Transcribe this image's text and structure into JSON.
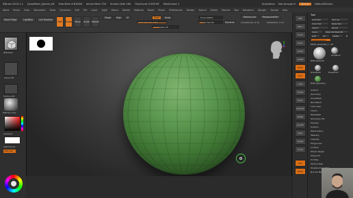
{
  "titlebar": {
    "items": [
      "ZBrush 2023.1.1",
      "DynaMesh_Sphere_64",
      "Free Mem 8.639GB",
      "Active Mem 726",
      "Scratch Disk 165",
      "PolyCount 0.009 KP",
      "MeshCount 1"
    ],
    "right": [
      "QuickSave",
      "See-through 0",
      "Menus",
      "DefaultZScript"
    ],
    "menus_label": "Menus"
  },
  "menubar": {
    "items": [
      "Alpha",
      "Brush",
      "Color",
      "Document",
      "Draw",
      "Dynamics",
      "Edit",
      "File",
      "Layer",
      "Light",
      "Macro",
      "Marker",
      "Material",
      "Movie",
      "Picker",
      "Preferences",
      "Render",
      "Stencil",
      "Stroke",
      "Texture",
      "Tool",
      "Transform",
      "Zplugin",
      "Zscript",
      "Help"
    ]
  },
  "toolbar": {
    "home_page": "Home Page",
    "lightbox": "LightBox",
    "live_boolean": "Live Boolean",
    "edit": "Edit",
    "draw": "Draw",
    "move": "Move",
    "scale": "Scale",
    "rotate": "Rotate",
    "mrgb": "Mrgb",
    "rgb": "Rgb",
    "m": "M",
    "zadd": "Zadd",
    "zsub": "Zsub",
    "focal_shift": "Focal Shift 0",
    "draw_size": "Draw Size 64",
    "dynamic": "Dynamic",
    "replay_last": "ReplayLast",
    "replay_last_rel": "ReplayLastRel",
    "rgb_intensity": "Rgb Intensity 100",
    "z_intensity": "Z Intensity 25",
    "active_points": "ActivePoints: 9.7K",
    "total_points": "TotalPoints: 9.7K"
  },
  "lefttray": {
    "brush_label": "ZModeler",
    "alpha_label": "Alpha Off",
    "texture_label": "Texture Off",
    "material_label": "MatCap Gray",
    "gradient_label": "Gradient",
    "switch_color_label": "SwitchColor",
    "alternate_label": "Alternate"
  },
  "rightshelf": {
    "buttons": [
      "BPR",
      "SPix 3",
      "Scroll",
      "Zoom",
      "Actual",
      "AAHalf",
      "Persp",
      "Floor",
      "L.Sym",
      "Frame",
      "Move",
      "Zoom3D",
      "Rotate",
      "Line Fill",
      "PolyF",
      "Transp",
      "Ghost",
      "Solo",
      "Xpose"
    ]
  },
  "toolpanel": {
    "title": "Tool",
    "load_tool": "Load Tool",
    "save_as": "Save As",
    "copy_tool": "Copy Tool",
    "paste_tool": "Paste Tool",
    "import": "Import",
    "export": "Export",
    "clone": "Clone",
    "make_polymesh": "Make PolyMesh3D",
    "goz": "GoZ",
    "all": "All",
    "visible": "Visible",
    "r": "R",
    "lightbox_tools": "Lightbox▸Tools",
    "current_tool": "PM3D_Sphere3D_1 : 48",
    "tools": [
      "PM3D_Sphere3D",
      "AlphaBrush",
      "SimpleBrush",
      "EraserBrush",
      "PM3D_Sphere3D_1"
    ],
    "subpanels": [
      "Subtool",
      "Geometry",
      "ArrayMesh",
      "NanoMesh",
      "Thick Skin",
      "Layers",
      "FiberMesh",
      "Geometry HD",
      "Preview",
      "Surface",
      "Deformation",
      "Masking",
      "Visibility",
      "Polygroups",
      "Contact",
      "Morph Target",
      "Polypaint",
      "UV Map",
      "Texture Map",
      "Displacement Map",
      "Normal Map"
    ]
  }
}
